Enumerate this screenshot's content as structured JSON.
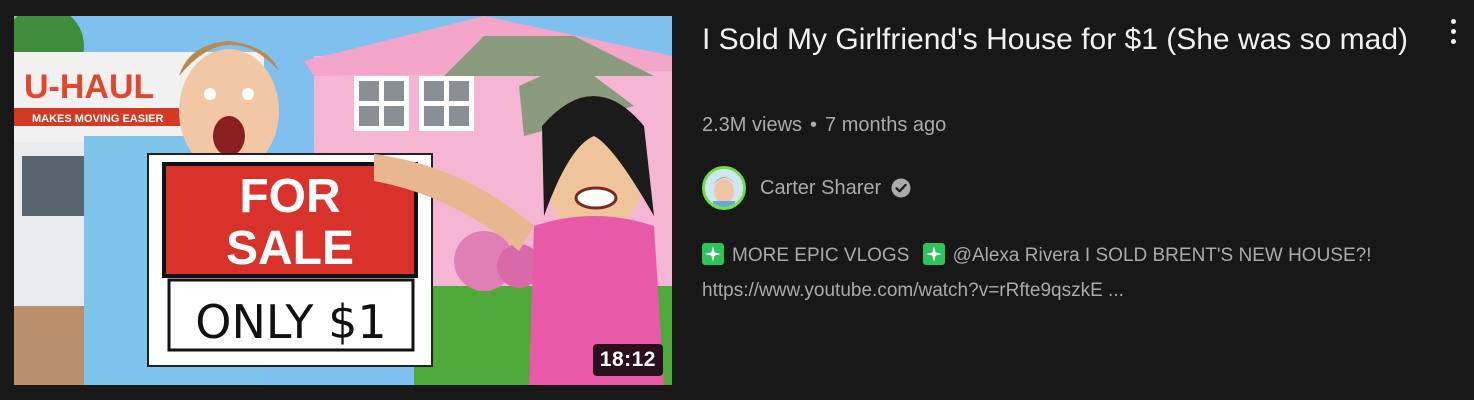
{
  "video": {
    "title": "I Sold My Girlfriend's House for $1 (She was so mad)",
    "views": "2.3M views",
    "separator": "•",
    "age": "7 months ago",
    "duration": "18:12"
  },
  "thumbnail": {
    "truck_brand": "U-HAUL",
    "truck_tagline": "MAKES MOVING EASIER",
    "sign_line1": "FOR",
    "sign_line2": "SALE",
    "sign_line3": "ONLY $1"
  },
  "channel": {
    "name": "Carter Sharer",
    "verified": true,
    "avatar_ring_color": "#6fe03c"
  },
  "description": {
    "prefix": "MORE EPIC VLOGS",
    "handle_line": "@Alexa Rivera I SOLD BRENT'S NEW HOUSE?!",
    "link": "https://www.youtube.com/watch?v=rRfte9qszkE ...",
    "sparkle_color": "#2ec45a"
  }
}
